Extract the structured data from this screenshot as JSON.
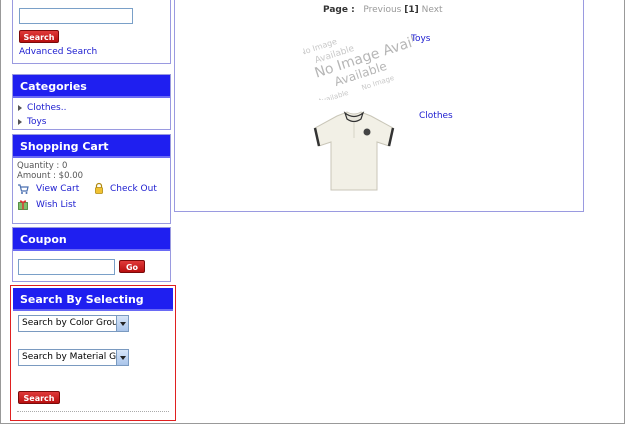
{
  "search": {
    "button_label": "Search",
    "advanced_link": "Advanced Search",
    "input_value": ""
  },
  "categories": {
    "title": "Categories",
    "items": [
      {
        "label": "Clothes.."
      },
      {
        "label": "Toys"
      }
    ]
  },
  "cart": {
    "title": "Shopping Cart",
    "quantity": "Quantity : 0",
    "amount": "Amount : $0.00",
    "view_cart": "View Cart",
    "check_out": "Check Out",
    "wish_list": "Wish List"
  },
  "coupon": {
    "title": "Coupon",
    "input_value": "",
    "go_label": "Go"
  },
  "search_by_selecting": {
    "title": "Search By Selecting",
    "color_select": "Search by Color Grou",
    "material_select": "Search by Material Gr",
    "button_label": "Search"
  },
  "main": {
    "pager": {
      "label": "Page :",
      "previous": "Previous",
      "current": "[1]",
      "next": "Next"
    },
    "products": [
      {
        "name": "Toys",
        "image": "No Image Available"
      },
      {
        "name": "Clothes"
      }
    ]
  },
  "colors": {
    "panel_header": "#1f1ff0",
    "link": "#2020d0",
    "button": "#c01818",
    "highlight_border": "#e02020"
  }
}
